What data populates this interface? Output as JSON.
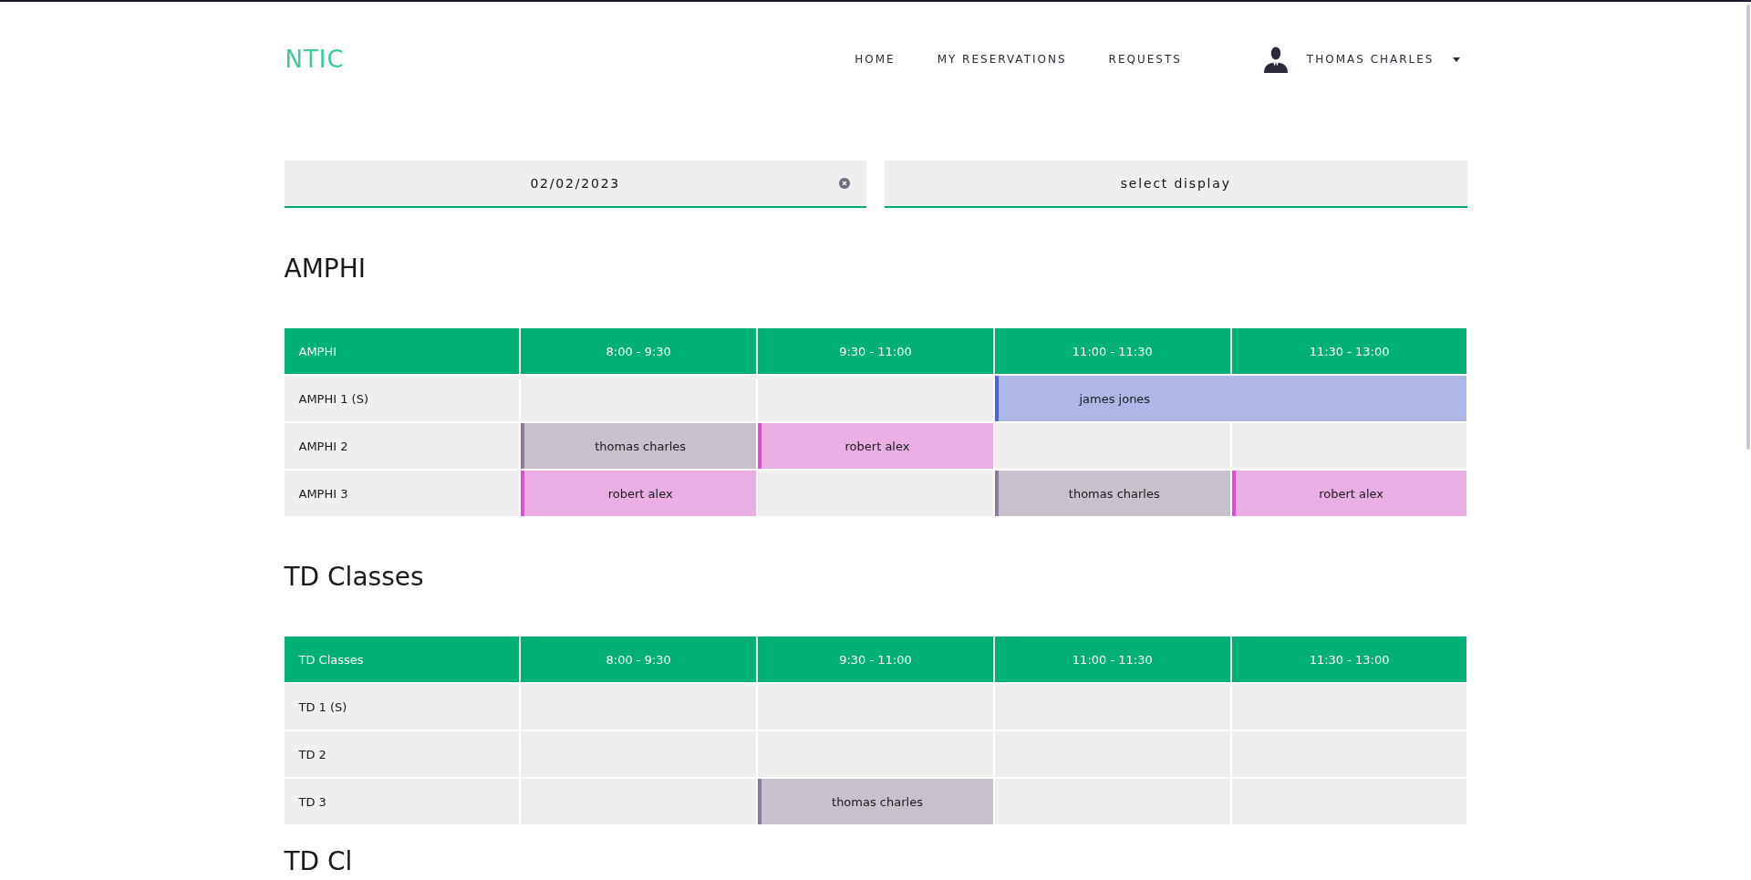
{
  "nav": {
    "logo": "NTIC",
    "links": [
      {
        "label": "HOME"
      },
      {
        "label": "MY RESERVATIONS"
      },
      {
        "label": "REQUESTS"
      }
    ],
    "user": {
      "name": "THOMAS CHARLES"
    }
  },
  "filters": {
    "date": {
      "value": "02/02/2023"
    },
    "display_select": {
      "value": "select display"
    }
  },
  "sections": [
    {
      "title": "AMPHI",
      "table": {
        "columns": [
          "AMPHI",
          "8:00 - 9:30",
          "9:30 - 11:00",
          "11:00 - 11:30",
          "11:30 - 13:00"
        ],
        "rows": [
          {
            "label": "AMPHI 1 (S)",
            "slots": [
              {
                "kind": "empty"
              },
              {
                "kind": "empty"
              },
              {
                "kind": "reservation",
                "name": "james jones",
                "color": "#4f63d8",
                "wide": true
              }
            ]
          },
          {
            "label": "AMPHI 2",
            "slots": [
              {
                "kind": "reservation",
                "name": "thomas charles",
                "color": "#8e7d9a",
                "wide": false
              },
              {
                "kind": "reservation",
                "name": "robert alex",
                "color": "#e04ed0",
                "wide": false
              },
              {
                "kind": "empty"
              },
              {
                "kind": "empty"
              }
            ]
          },
          {
            "label": "AMPHI 3",
            "slots": [
              {
                "kind": "reservation",
                "name": "robert alex",
                "color": "#e04ed0",
                "wide": false
              },
              {
                "kind": "empty"
              },
              {
                "kind": "reservation",
                "name": "thomas charles",
                "color": "#8e7d9a",
                "wide": false
              },
              {
                "kind": "reservation",
                "name": "robert alex",
                "color": "#e04ed0",
                "wide": false
              }
            ]
          }
        ]
      }
    },
    {
      "title": "TD Classes",
      "table": {
        "columns": [
          "TD Classes",
          "8:00 - 9:30",
          "9:30 - 11:00",
          "11:00 - 11:30",
          "11:30 - 13:00"
        ],
        "rows": [
          {
            "label": "TD 1 (S)",
            "slots": [
              {
                "kind": "empty"
              },
              {
                "kind": "empty"
              },
              {
                "kind": "empty"
              },
              {
                "kind": "empty"
              }
            ]
          },
          {
            "label": "TD 2",
            "slots": [
              {
                "kind": "empty"
              },
              {
                "kind": "empty"
              },
              {
                "kind": "empty"
              },
              {
                "kind": "empty"
              }
            ]
          },
          {
            "label": "TD 3",
            "slots": [
              {
                "kind": "empty"
              },
              {
                "kind": "reservation",
                "name": "thomas charles",
                "color": "#8e7d9a",
                "wide": false
              },
              {
                "kind": "empty"
              },
              {
                "kind": "empty"
              }
            ]
          }
        ]
      }
    },
    {
      "title": "TD Cl"
    }
  ]
}
